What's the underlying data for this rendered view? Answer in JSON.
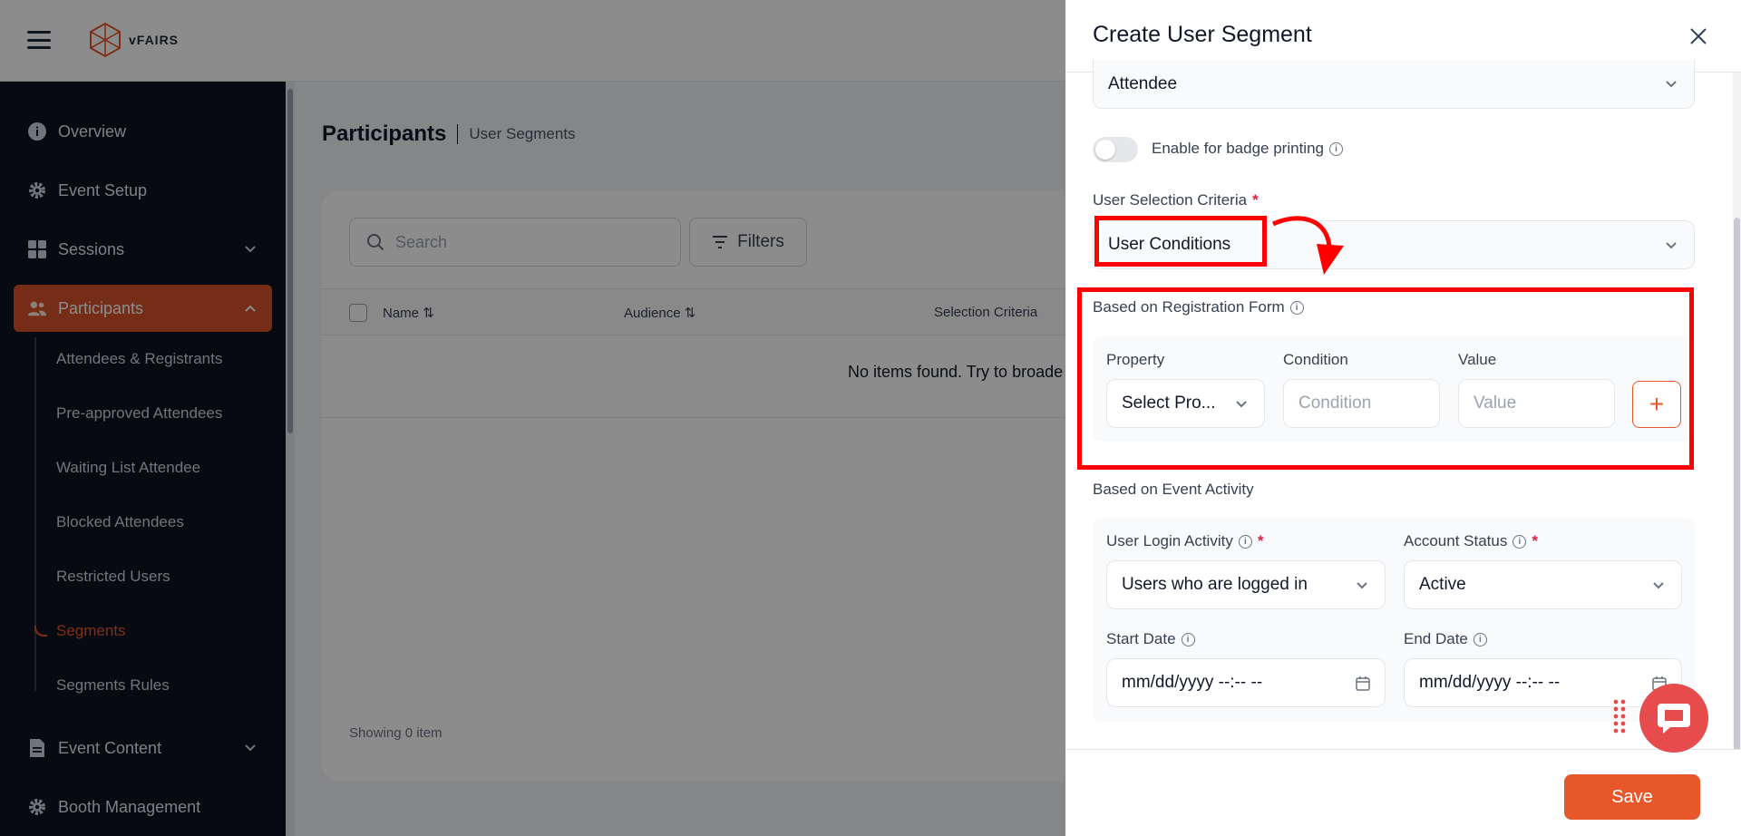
{
  "header": {
    "logo_text": "vFAIRS"
  },
  "sidebar": {
    "items": [
      {
        "label": "Overview",
        "icon": "info-icon"
      },
      {
        "label": "Event Setup",
        "icon": "gear-icon"
      },
      {
        "label": "Sessions",
        "icon": "grid-icon"
      },
      {
        "label": "Participants",
        "icon": "users-icon"
      },
      {
        "label": "Event Content",
        "icon": "document-icon"
      },
      {
        "label": "Booth Management",
        "icon": "gear-icon"
      }
    ],
    "sub_items": [
      "Attendees & Registrants",
      "Pre-approved Attendees",
      "Waiting List Attendee",
      "Blocked Attendees",
      "Restricted Users",
      "Segments",
      "Segments Rules"
    ],
    "active_item": "Participants",
    "active_sub_item": "Segments"
  },
  "main": {
    "title": "Participants",
    "breadcrumb": "User Segments",
    "search_placeholder": "Search",
    "filters_label": "Filters",
    "columns": [
      "Name",
      "Audience",
      "Selection Criteria"
    ],
    "empty_message": "No items found. Try to broade",
    "showing_text": "Showing 0 item"
  },
  "drawer": {
    "title": "Create User Segment",
    "audience_value": "Attendee",
    "badge_toggle_label": "Enable for badge printing",
    "badge_toggle_on": false,
    "criteria_label": "User Selection Criteria",
    "criteria_value": "User Conditions",
    "registration_section": "Based on Registration Form",
    "property_label": "Property",
    "property_value": "Select Pro...",
    "condition_label": "Condition",
    "condition_placeholder": "Condition",
    "value_label": "Value",
    "value_placeholder": "Value",
    "activity_section": "Based on Event Activity",
    "login_activity_label": "User Login Activity",
    "login_activity_value": "Users who are logged in",
    "account_status_label": "Account Status",
    "account_status_value": "Active",
    "start_date_label": "Start Date",
    "start_date_placeholder": "mm/dd/yyyy --:-- --",
    "end_date_label": "End Date",
    "end_date_placeholder": "mm/dd/yyyy --:-- --",
    "save_label": "Save"
  },
  "colors": {
    "accent": "#e8572a",
    "sidebar_bg": "#0f1320",
    "annotation": "#ff0000",
    "chat": "#e74c4c"
  }
}
